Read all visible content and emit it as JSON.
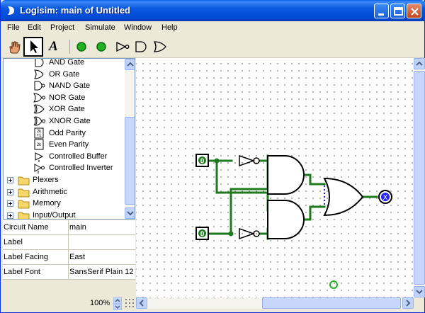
{
  "window": {
    "title": "Logisim: main of Untitled"
  },
  "menu": [
    "File",
    "Edit",
    "Project",
    "Simulate",
    "Window",
    "Help"
  ],
  "toolbar": {
    "tools": [
      "poke-tool",
      "select-tool",
      "text-tool",
      "input-pin",
      "output-pin",
      "not-gate",
      "and-gate",
      "or-gate"
    ],
    "text_tool_glyph": "A"
  },
  "explorer": {
    "gates": [
      {
        "label": "AND Gate",
        "icon": "and-gate-icon"
      },
      {
        "label": "OR Gate",
        "icon": "or-gate-icon"
      },
      {
        "label": "NAND Gate",
        "icon": "nand-gate-icon"
      },
      {
        "label": "NOR Gate",
        "icon": "nor-gate-icon"
      },
      {
        "label": "XOR Gate",
        "icon": "xor-gate-icon"
      },
      {
        "label": "XNOR Gate",
        "icon": "xnor-gate-icon"
      },
      {
        "label": "Odd Parity",
        "icon": "odd-parity-icon"
      },
      {
        "label": "Even Parity",
        "icon": "even-parity-icon"
      },
      {
        "label": "Controlled Buffer",
        "icon": "controlled-buffer-icon"
      },
      {
        "label": "Controlled Inverter",
        "icon": "controlled-inverter-icon"
      }
    ],
    "folders": [
      "Plexers",
      "Arithmetic",
      "Memory",
      "Input/Output"
    ],
    "parity_glyphs": {
      "odd": "2k\n+1",
      "even": "2k"
    }
  },
  "attributes": [
    {
      "key": "Circuit Name",
      "value": "main"
    },
    {
      "key": "Label",
      "value": ""
    },
    {
      "key": "Label Facing",
      "value": "East"
    },
    {
      "key": "Label Font",
      "value": "SansSerif Plain 12"
    }
  ],
  "zoom": "100%",
  "circuit": {
    "input_a": "0",
    "input_b": "0",
    "output": "X",
    "colors": {
      "wire_on": "#008A00",
      "wire_off": "#1E6E1E",
      "error": "#2020FF",
      "gate": "#000000"
    }
  }
}
